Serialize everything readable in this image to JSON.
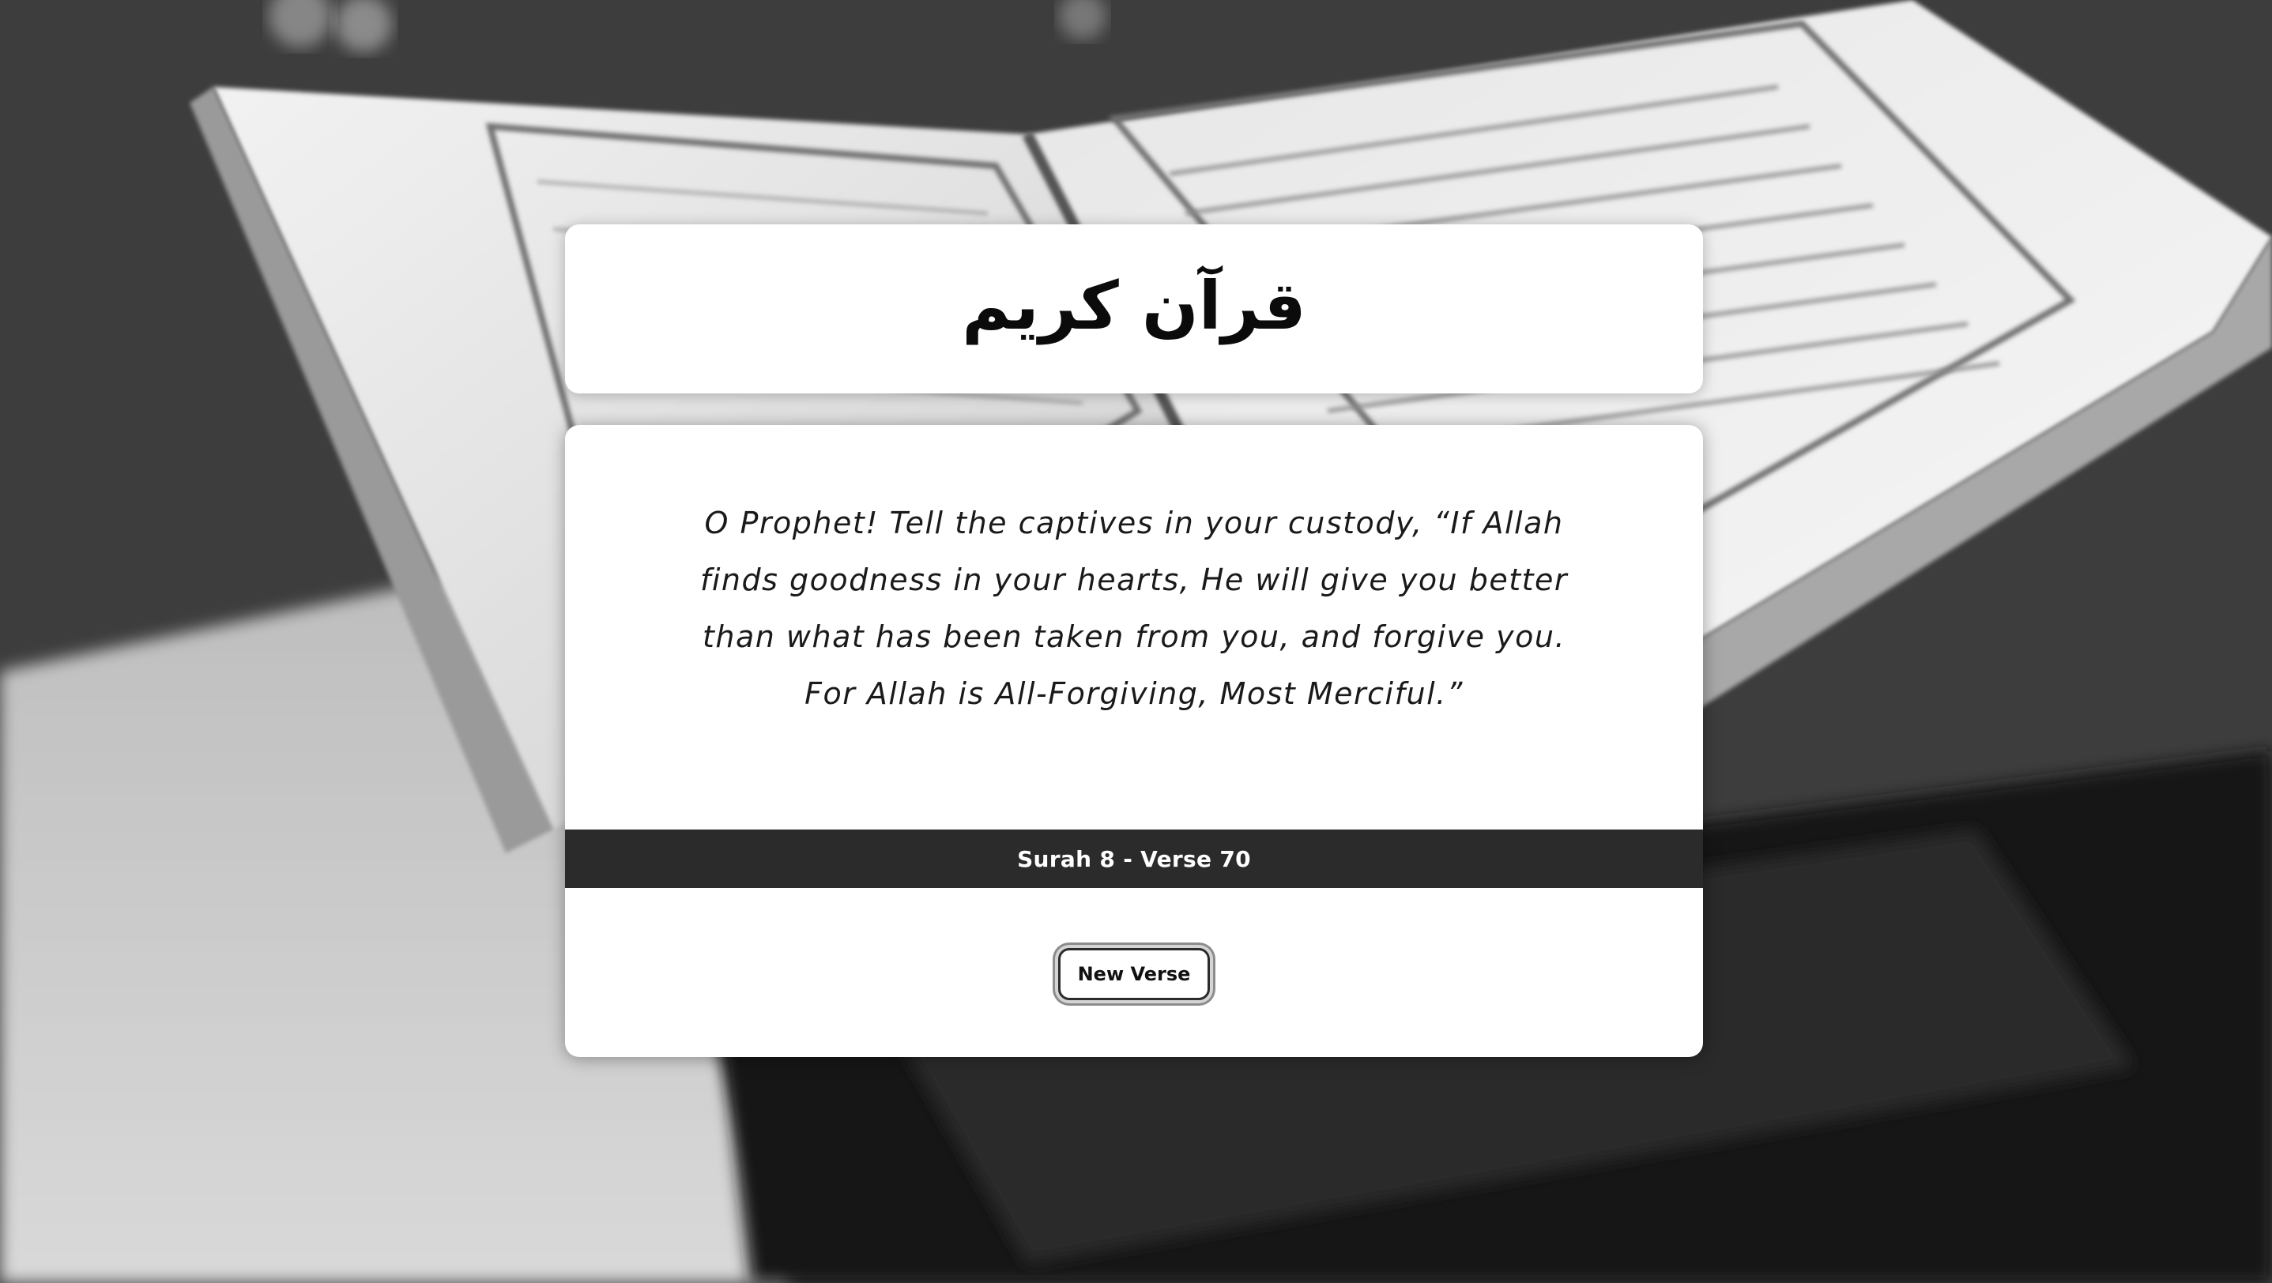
{
  "title": "قرآن كريم",
  "verse": {
    "text": "O Prophet! Tell the captives in your custody, “If Allah finds goodness in your hearts, He will give you better than what has been taken from you, and forgive you. For Allah is All-Forgiving, Most Merciful.”",
    "reference": "Surah 8 - Verse 70"
  },
  "actions": {
    "new_verse_label": "New Verse"
  },
  "background": {
    "description_icon": "open-quran-on-stand-photo",
    "tone": "grayscale"
  },
  "colors": {
    "card_background": "#ffffff",
    "reference_bar": "#2b2b2b",
    "text_primary": "#111111"
  }
}
